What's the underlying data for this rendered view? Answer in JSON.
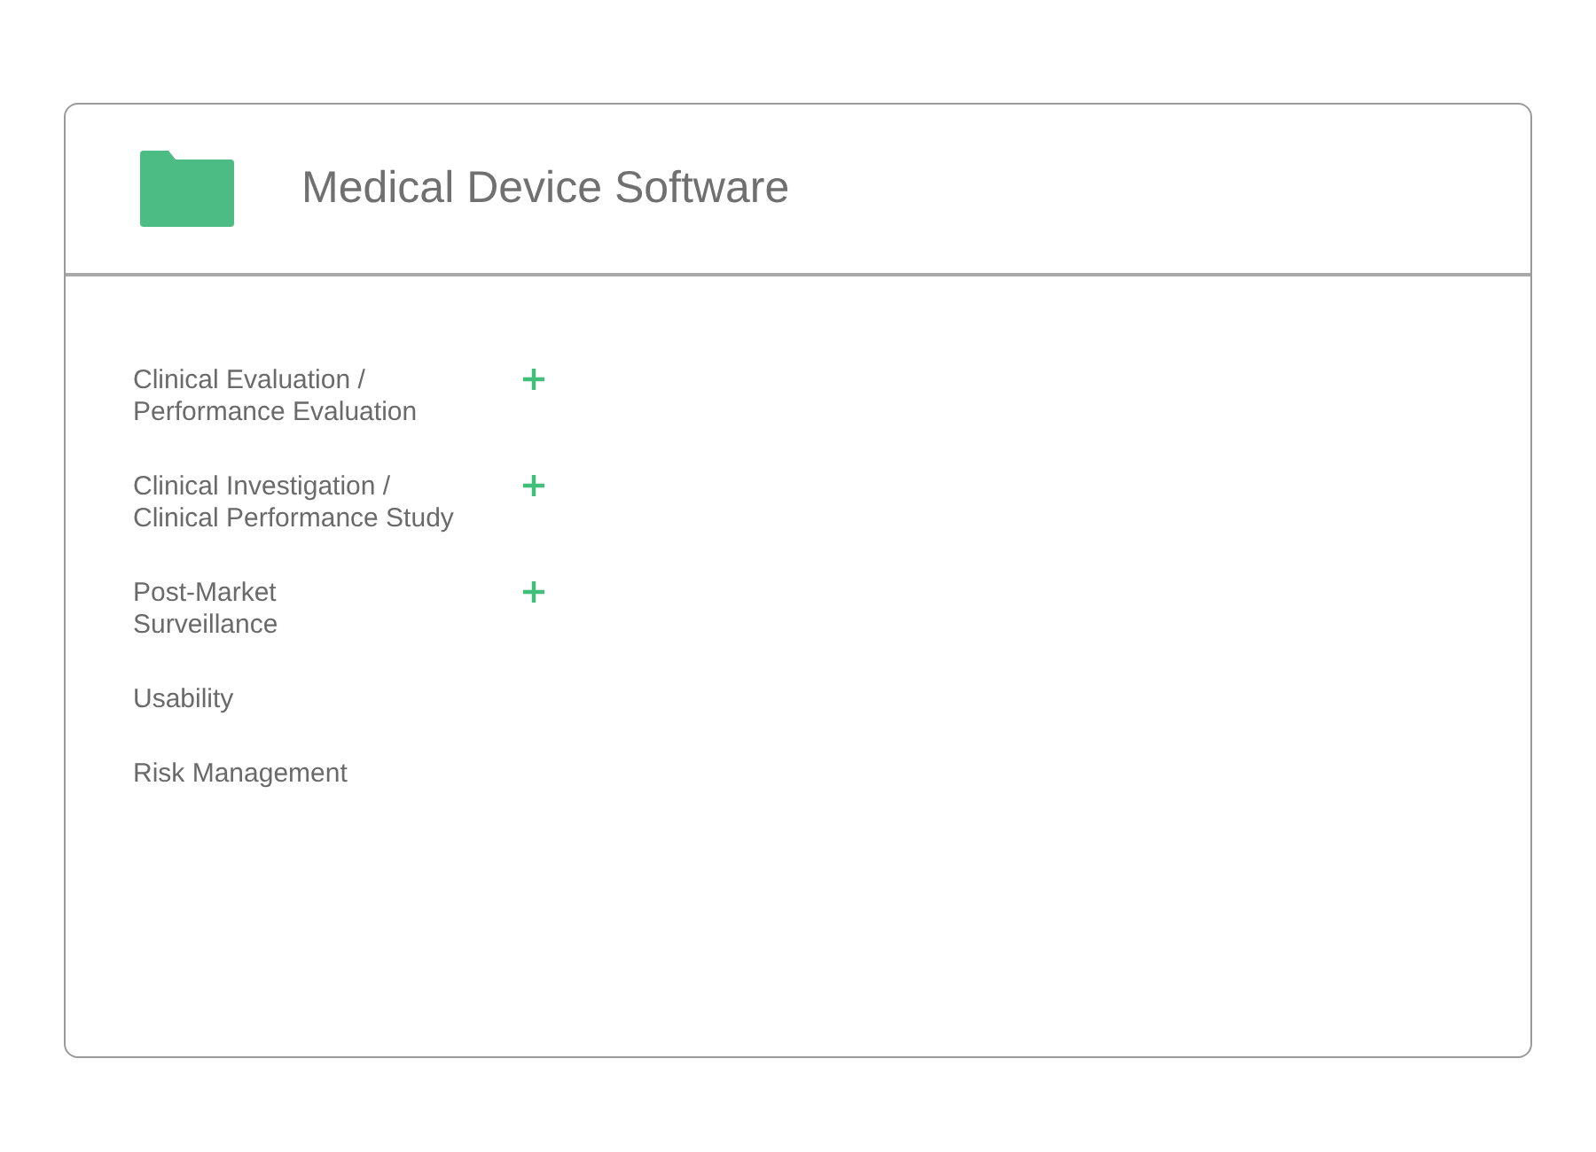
{
  "header": {
    "title": "Medical Device Software"
  },
  "items": [
    {
      "kind": "expandable",
      "lines": [
        "Clinical Evaluation /",
        "Performance Evaluation"
      ]
    },
    {
      "kind": "expandable",
      "lines": [
        "Clinical Investigation /",
        "Clinical Performance Study"
      ]
    },
    {
      "kind": "expandable",
      "lines": [
        "Post-Market",
        "Surveillance"
      ]
    },
    {
      "kind": "plain",
      "lines": [
        "Usability"
      ]
    },
    {
      "kind": "plain",
      "lines": [
        "Risk Management"
      ]
    }
  ]
}
